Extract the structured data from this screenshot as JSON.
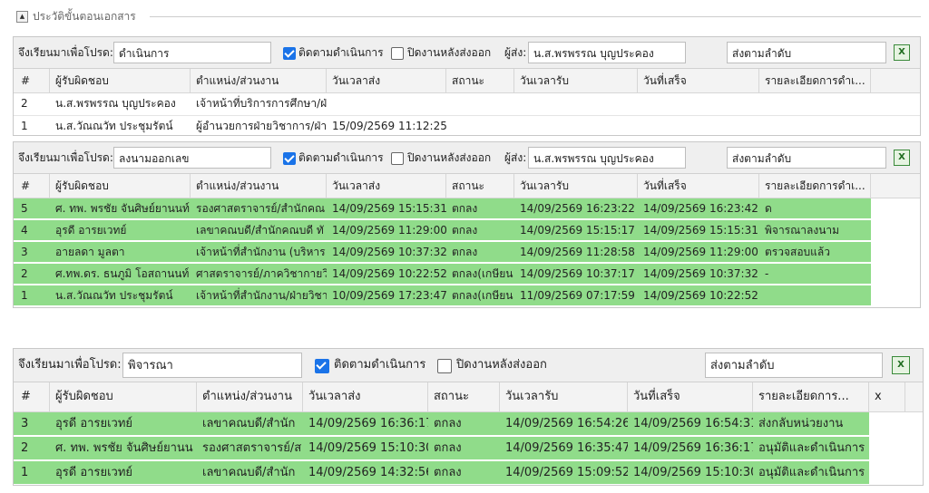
{
  "section": {
    "title": "ประวัติขั้นตอนเอกสาร",
    "toggle_icon": "triangle-up-icon"
  },
  "labels": {
    "purpose": "จึงเรียนมาเพื่อโปรด:",
    "track": "ติดตามดำเนินการ",
    "close": "ปิดงานหลังส่งออก",
    "sender": "ผู้ส่ง:",
    "export_icon": "excel-export-icon"
  },
  "panels": [
    {
      "purpose_value": "ดำเนินการ",
      "track_checked": true,
      "close_checked": false,
      "sender_value": "น.ส.พรพรรณ บุญประคอง",
      "order_value": "ส่งตามลำดับ",
      "columns": [
        "#",
        "ผู้รับผิดชอบ",
        "ตำแหน่ง/ส่วนงาน",
        "วันเวลาส่ง",
        "สถานะ",
        "วันเวลารับ",
        "วันที่เสร็จ",
        "รายละเอียดการดำเ..."
      ],
      "rows": [
        {
          "no": "2",
          "person": "น.ส.พรพรรณ บุญประคอง",
          "position": "เจ้าหน้าที่บริการการศึกษา/ฝ่",
          "sent": "",
          "status": "",
          "received": "",
          "finished": "",
          "detail": "",
          "done": false
        },
        {
          "no": "1",
          "person": "น.ส.วัณณวัท ประชุมรัตน์",
          "position": "ผู้อำนวยการฝ่ายวิชาการ/ฝ่า",
          "sent": "15/09/2569 11:12:25",
          "status": "",
          "received": "",
          "finished": "",
          "detail": "",
          "done": false
        }
      ]
    },
    {
      "purpose_value": "ลงนามออกเลข",
      "track_checked": true,
      "close_checked": false,
      "sender_value": "น.ส.พรพรรณ บุญประคอง",
      "order_value": "ส่งตามลำดับ",
      "columns": [
        "#",
        "ผู้รับผิดชอบ",
        "ตำแหน่ง/ส่วนงาน",
        "วันเวลาส่ง",
        "สถานะ",
        "วันเวลารับ",
        "วันที่เสร็จ",
        "รายละเอียดการดำเ..."
      ],
      "rows": [
        {
          "no": "5",
          "person": "ศ. ทพ. พรชัย จันศิษย์ยานนท์",
          "position": "รองศาสตราจารย์/สำนักคณ",
          "sent": "14/09/2569 15:15:31",
          "status": "ตกลง",
          "received": "14/09/2569 16:23:22",
          "finished": "14/09/2569 16:23:42",
          "detail": "ด",
          "done": true
        },
        {
          "no": "4",
          "person": "อุรดี อารยเวทย์",
          "position": "เลขาคณบดี/สำนักคณบดี ทั",
          "sent": "14/09/2569 11:29:00",
          "status": "ตกลง",
          "received": "14/09/2569 15:15:17",
          "finished": "14/09/2569 15:15:31",
          "detail": "พิจารณาลงนาม",
          "done": true
        },
        {
          "no": "3",
          "person": "อายลดา มูลตา",
          "position": "เจ้าหน้าที่สำนักงาน (บริหาร",
          "sent": "14/09/2569 10:37:32",
          "status": "ตกลง",
          "received": "14/09/2569 11:28:58",
          "finished": "14/09/2569 11:29:00",
          "detail": "ตรวจสอบแล้ว",
          "done": true
        },
        {
          "no": "2",
          "person": "ศ.ทพ.ดร. ธนภูมิ โอสถานนท์",
          "position": "ศาสตราจารย์/ภาควิชากายวิ",
          "sent": "14/09/2569 10:22:52",
          "status": "ตกลง(เกษียน",
          "received": "14/09/2569 10:37:17",
          "finished": "14/09/2569 10:37:32",
          "detail": "-",
          "done": true
        },
        {
          "no": "1",
          "person": "น.ส.วัณณวัท ประชุมรัตน์",
          "position": "เจ้าหน้าที่สำนักงาน/ฝ่ายวิชา",
          "sent": "10/09/2569 17:23:47",
          "status": "ตกลง(เกษียน",
          "received": "11/09/2569 07:17:59",
          "finished": "14/09/2569 10:22:52",
          "detail": "",
          "done": true
        }
      ]
    },
    {
      "purpose_value": "พิจารณา",
      "track_checked": true,
      "close_checked": false,
      "order_value": "ส่งตามลำดับ",
      "columns": [
        "#",
        "ผู้รับผิดชอบ",
        "ตำแหน่ง/ส่วนงาน",
        "วันเวลาส่ง",
        "สถานะ",
        "วันเวลารับ",
        "วันที่เสร็จ",
        "รายละเอียดการ...",
        "x"
      ],
      "rows": [
        {
          "no": "3",
          "person": "อุรดี อารยเวทย์",
          "position": "เลขาคณบดี/สำนัก",
          "sent": "14/09/2569 16:36:17",
          "status": "ตกลง",
          "received": "14/09/2569 16:54:26",
          "finished": "14/09/2569 16:54:31",
          "detail": "ส่งกลับหน่วยงาน",
          "done": true
        },
        {
          "no": "2",
          "person": "ศ. ทพ. พรชัย จันศิษย์ยานน",
          "position": "รองศาสตราจารย์/ส",
          "sent": "14/09/2569 15:10:30",
          "status": "ตกลง",
          "received": "14/09/2569 16:35:47",
          "finished": "14/09/2569 16:36:17",
          "detail": "อนุมัติและดำเนินการ",
          "done": true
        },
        {
          "no": "1",
          "person": "อุรดี อารยเวทย์",
          "position": "เลขาคณบดี/สำนัก",
          "sent": "14/09/2569 14:32:56",
          "status": "ตกลง",
          "received": "14/09/2569 15:09:52",
          "finished": "14/09/2569 15:10:30",
          "detail": "อนุมัติและดำเนินการ",
          "done": true
        }
      ]
    }
  ]
}
